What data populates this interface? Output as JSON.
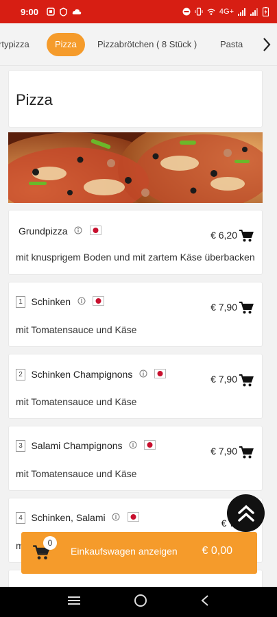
{
  "status_bar": {
    "time": "9:00",
    "network": "4G+",
    "icons_left": [
      "notification-icon",
      "shield-icon",
      "cloud-icon"
    ],
    "icons_right": [
      "dnd-icon",
      "vibrate-icon",
      "wifi-calling-icon",
      "signal-icon",
      "battery-icon"
    ]
  },
  "tabs": {
    "items": [
      {
        "label": "rtypizza",
        "active": false
      },
      {
        "label": "Pizza",
        "active": true
      },
      {
        "label": "Pizzabrötchen ( 8 Stück )",
        "active": false
      },
      {
        "label": "Pasta",
        "active": false
      }
    ],
    "next_icon": "chevron-right-icon"
  },
  "section": {
    "title": "Pizza"
  },
  "items": [
    {
      "number": "",
      "name": "Grundpizza",
      "price": "€ 6,20",
      "description": "mit knusprigem Boden und mit zartem Käse überbacken"
    },
    {
      "number": "1",
      "name": "Schinken",
      "price": "€ 7,90",
      "description": "mit Tomatensauce und Käse"
    },
    {
      "number": "2",
      "name": "Schinken Champignons",
      "price": "€ 7,90",
      "description": "mit Tomatensauce und Käse"
    },
    {
      "number": "3",
      "name": "Salami Champignons",
      "price": "€ 7,90",
      "description": "mit Tomatensauce und Käse"
    },
    {
      "number": "4",
      "name": "Schinken, Salami",
      "price": "€ 7,",
      "description": "m"
    }
  ],
  "cart": {
    "count": "0",
    "label": "Einkaufswagen anzeigen",
    "total": "€ 0,00"
  },
  "colors": {
    "status_bar": "#d71e13",
    "accent": "#f59b2b",
    "scroll_button": "#111111"
  }
}
